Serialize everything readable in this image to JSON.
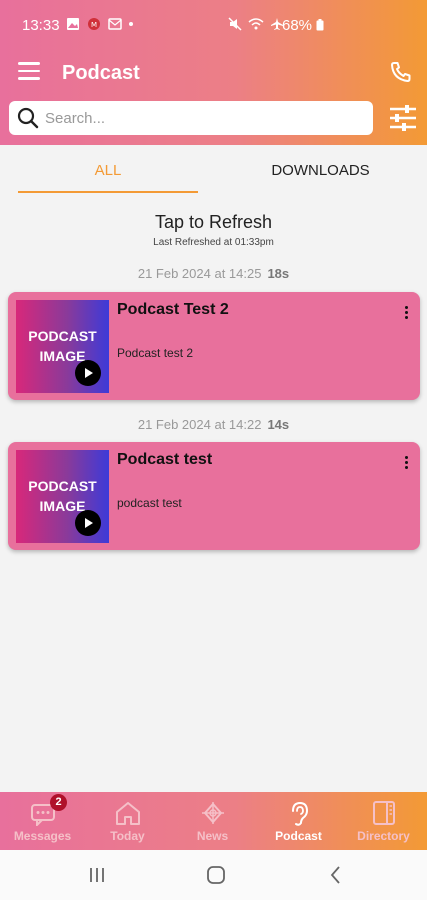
{
  "status_bar": {
    "time": "13:33",
    "battery": "68%"
  },
  "app_bar": {
    "title": "Podcast"
  },
  "search": {
    "placeholder": "Search..."
  },
  "tabs": [
    {
      "label": "ALL",
      "active": true
    },
    {
      "label": "DOWNLOADS",
      "active": false
    }
  ],
  "refresh": {
    "title": "Tap to Refresh",
    "subtitle": "Last Refreshed at  01:33pm"
  },
  "episodes": [
    {
      "date": "21 Feb 2024 at 14:25",
      "duration": "18s",
      "title": "Podcast Test 2",
      "description": "Podcast test 2",
      "image_line1": "PODCAST",
      "image_line2": "IMAGE"
    },
    {
      "date": "21 Feb 2024 at 14:22",
      "duration": "14s",
      "title": "Podcast test",
      "description": "podcast test",
      "image_line1": "PODCAST",
      "image_line2": "IMAGE"
    }
  ],
  "bottom_nav": [
    {
      "label": "Messages",
      "icon": "message-icon",
      "badge": "2"
    },
    {
      "label": "Today",
      "icon": "home-icon"
    },
    {
      "label": "News",
      "icon": "news-icon"
    },
    {
      "label": "Podcast",
      "icon": "ear-icon",
      "active": true
    },
    {
      "label": "Directory",
      "icon": "directory-icon"
    }
  ],
  "colors": {
    "accent": "#f39a35",
    "pink": "#e8709c"
  }
}
